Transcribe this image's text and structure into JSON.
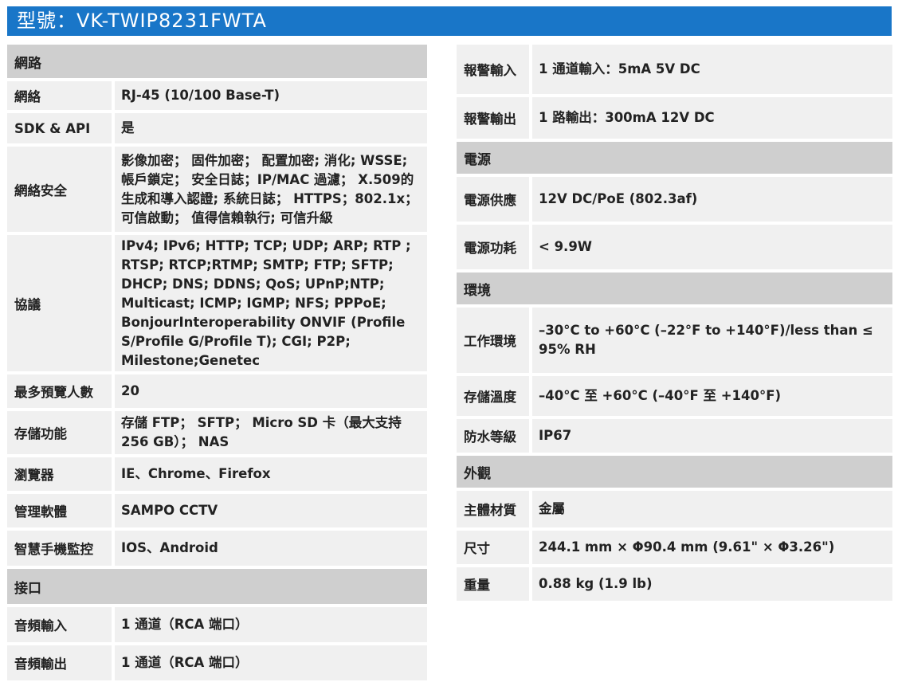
{
  "header": {
    "title": "型號：VK-TWIP8231FWTA"
  },
  "left": {
    "network_section": "網路",
    "network_rows": [
      {
        "label": "網絡",
        "value": "RJ-45 (10/100 Base-T)"
      },
      {
        "label": "SDK & API",
        "value": "是"
      },
      {
        "label": "網絡安全",
        "value": "影像加密； 固件加密； 配置加密; 消化; WSSE; 帳戶鎖定； 安全日誌；IP/MAC 過濾； X.509的生成和導入認證; 系統日誌； HTTPS；802.1x； 可信啟動； 值得信賴執行; 可信升級"
      },
      {
        "label": "協議",
        "value": "IPv4; IPv6; HTTP; TCP; UDP; ARP; RTP ; RTSP; RTCP;RTMP; SMTP; FTP; SFTP; DHCP; DNS; DDNS; QoS; UPnP;NTP; Multicast; ICMP; IGMP; NFS; PPPoE; BonjourInteroperability ONVIF (Profile S/Profile G/Profile T); CGI; P2P; Milestone;Genetec"
      },
      {
        "label": "最多預覽人數",
        "value": "20"
      },
      {
        "label": "存儲功能",
        "value": "存儲 FTP； SFTP； Micro SD 卡（最大支持 256 GB）； NAS"
      },
      {
        "label": "瀏覽器",
        "value": "IE、Chrome、Firefox"
      },
      {
        "label": "管理軟體",
        "value": "SAMPO CCTV"
      },
      {
        "label": "智慧手機監控",
        "value": "IOS、Android"
      }
    ],
    "interface_section": "接口",
    "interface_rows": [
      {
        "label": "音頻輸入",
        "value": "1 通道（RCA 端口）"
      },
      {
        "label": "音頻輸出",
        "value": "1 通道（RCA 端口）"
      }
    ]
  },
  "right": {
    "alarm_rows": [
      {
        "label": "報警輸入",
        "value": "1 通道輸入：5mA 5V DC"
      },
      {
        "label": "報警輸出",
        "value": "1 路輸出：300mA 12V DC"
      }
    ],
    "power_section": "電源",
    "power_rows": [
      {
        "label": "電源供應",
        "value": "12V DC/PoE (802.3af)"
      },
      {
        "label": "電源功耗",
        "value": "< 9.9W"
      }
    ],
    "environment_section": "環境",
    "environment_rows": [
      {
        "label": "工作環境",
        "value": "–30°C to +60°C (–22°F to +140°F)/less than ≤ 95% RH"
      },
      {
        "label": "存儲溫度",
        "value": "–40°C 至 +60°C (–40°F 至 +140°F)"
      },
      {
        "label": "防水等級",
        "value": "IP67"
      }
    ],
    "appearance_section": "外觀",
    "appearance_rows": [
      {
        "label": "主體材質",
        "value": "金屬"
      },
      {
        "label": "尺寸",
        "value": "244.1 mm × Φ90.4 mm (9.61\" × Φ3.26\")"
      },
      {
        "label": "重量",
        "value": "0.88 kg (1.9 lb)"
      }
    ]
  }
}
